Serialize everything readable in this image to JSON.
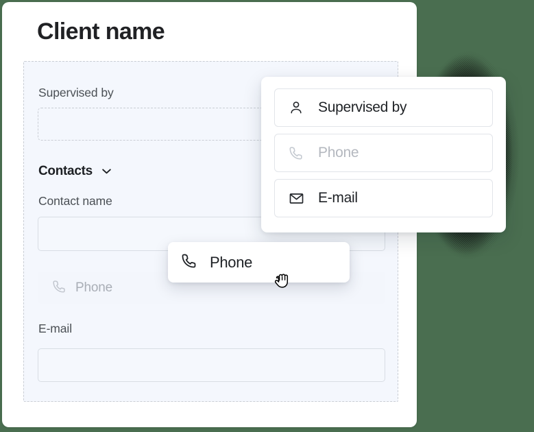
{
  "page": {
    "background_color": "#4a6e50",
    "card_background": "#ffffff"
  },
  "form_card": {
    "title": "Client name",
    "dropzone": {
      "background_color": "#f4f7fd",
      "border_style": "dashed",
      "border_color": "#c9cdd4"
    },
    "fields": [
      {
        "label": "Supervised by",
        "type": "empty-slot",
        "state": "dashed-placeholder",
        "value": ""
      },
      {
        "label": "Contact name",
        "type": "text-input",
        "state": "solid",
        "value": ""
      },
      {
        "label": "",
        "type": "phone-placeholder",
        "state": "plain",
        "placeholder": "Phone",
        "icon": "phone-icon"
      },
      {
        "label": "E-mail",
        "type": "text-input",
        "state": "solid",
        "value": ""
      }
    ],
    "contacts_section": {
      "title": "Contacts",
      "collapse_icon": "chevron-down-icon",
      "expanded": true
    }
  },
  "field_type_panel": {
    "options": [
      {
        "label": "Supervised by",
        "icon": "user-icon",
        "disabled": false
      },
      {
        "label": "Phone",
        "icon": "phone-icon",
        "disabled": true
      },
      {
        "label": "E-mail",
        "icon": "envelope-icon",
        "disabled": false
      }
    ]
  },
  "drag_chip": {
    "label": "Phone",
    "icon": "phone-icon"
  },
  "cursor": {
    "type": "grabbing-hand-cursor"
  },
  "colors": {
    "page_green": "#4a6e50",
    "field_fill": "#f5f8fd",
    "dashed_border": "#c9cdd4",
    "muted_text": "#a9aeb6",
    "title_text": "#202124"
  }
}
